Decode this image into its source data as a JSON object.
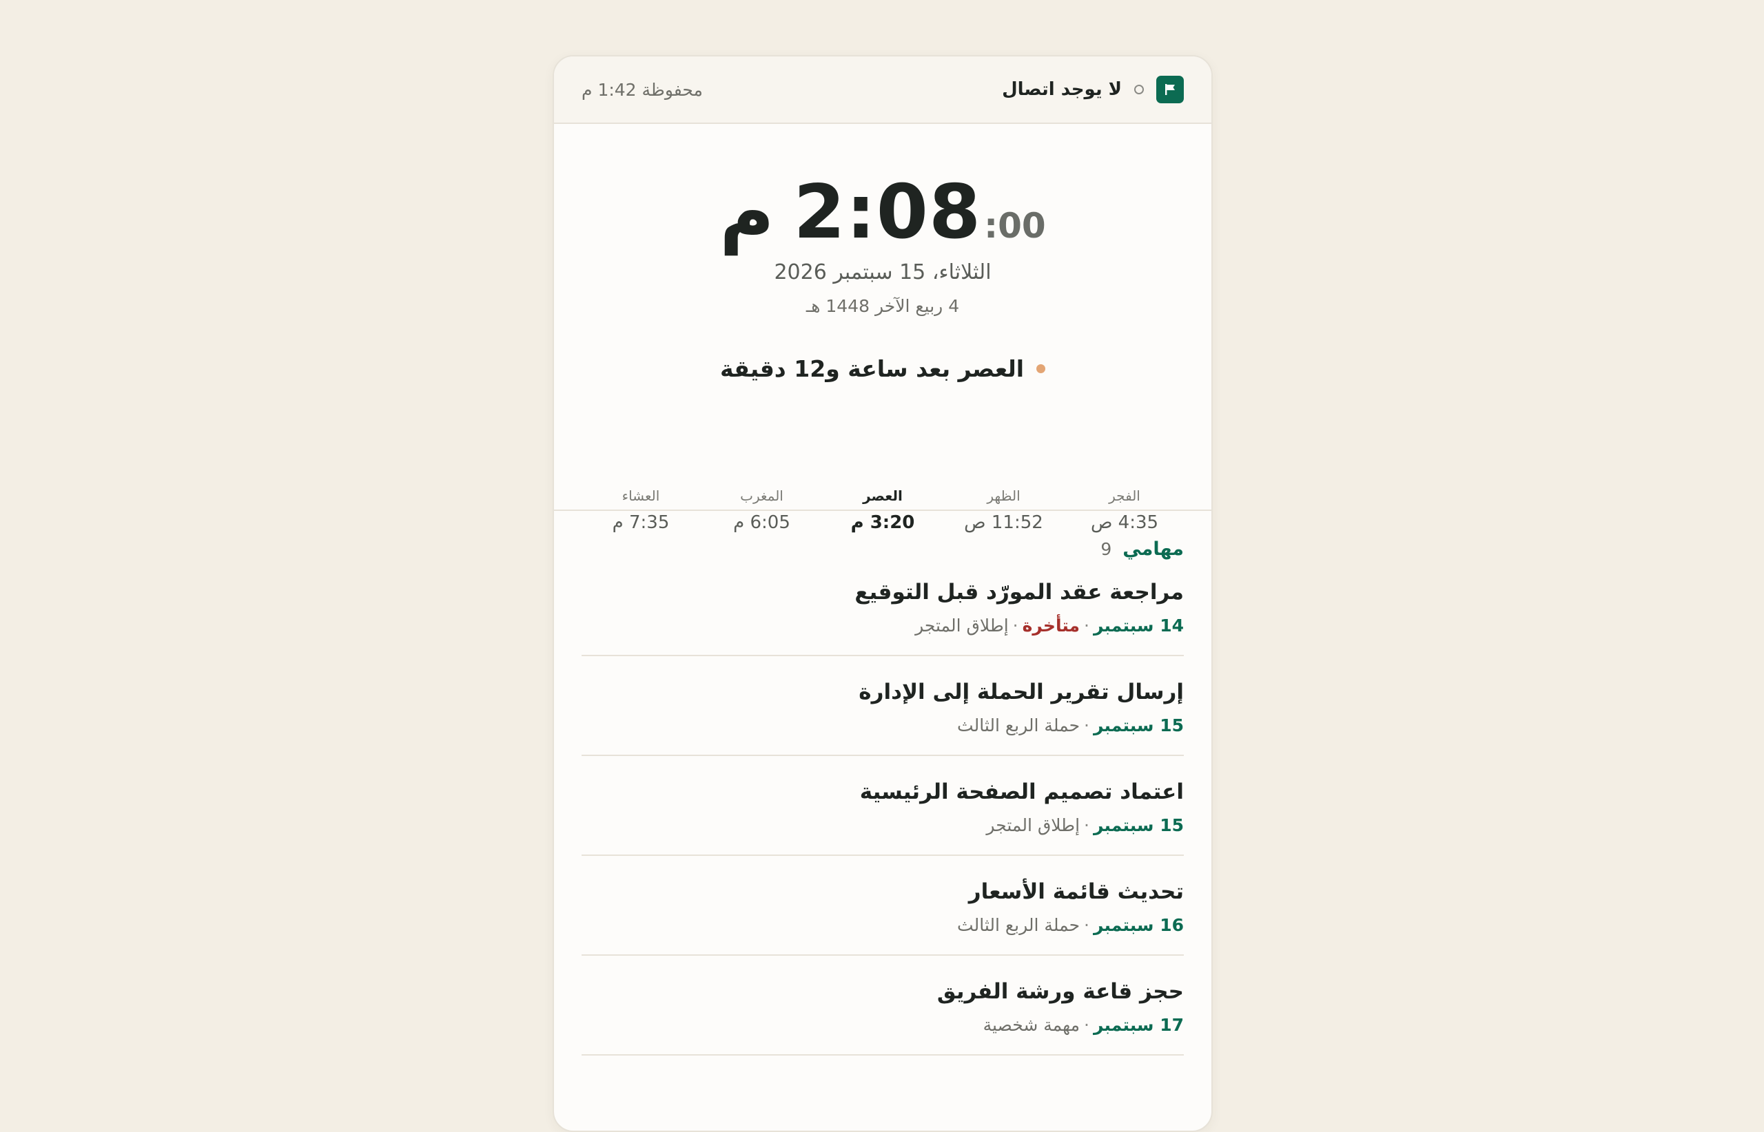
{
  "status": {
    "connection": "لا يوجد اتصال",
    "saved": "محفوظة 1:42 م",
    "icons": {
      "flag": "flag-icon",
      "dot": "status-dot-icon"
    },
    "accent_color": "#0c6b52"
  },
  "clock": {
    "time": "2:08",
    "seconds": ":00",
    "period": "م",
    "gregorian_date": "الثلاثاء، 15 سبتمبر 2026",
    "hijri_date": "4 ربيع الآخر 1448 هـ"
  },
  "next_prayer": {
    "text": "العصر بعد ساعة و12 دقيقة",
    "dot_color": "#e3a574"
  },
  "prayers": [
    {
      "name": "الفجر",
      "time": "4:35 ص"
    },
    {
      "name": "الظهر",
      "time": "11:52 ص"
    },
    {
      "name": "العصر",
      "time": "3:20 م",
      "current": true
    },
    {
      "name": "المغرب",
      "time": "6:05 م"
    },
    {
      "name": "العشاء",
      "time": "7:35 م"
    }
  ],
  "tasks": {
    "title": "مهامي",
    "count": "9",
    "items": [
      {
        "title": "مراجعة عقد المورّد قبل التوقيع",
        "date": "14 سبتمبر",
        "overdue": "متأخرة",
        "project": "إطلاق المتجر"
      },
      {
        "title": "إرسال تقرير الحملة إلى الإدارة",
        "date": "15 سبتمبر",
        "project": "حملة الربع الثالث"
      },
      {
        "title": "اعتماد تصميم الصفحة الرئيسية",
        "date": "15 سبتمبر",
        "project": "إطلاق المتجر"
      },
      {
        "title": "تحديث قائمة الأسعار",
        "date": "16 سبتمبر",
        "project": "حملة الربع الثالث"
      },
      {
        "title": "حجز قاعة ورشة الفريق",
        "date": "17 سبتمبر",
        "project": "مهمة شخصية"
      }
    ],
    "separator": "·"
  }
}
